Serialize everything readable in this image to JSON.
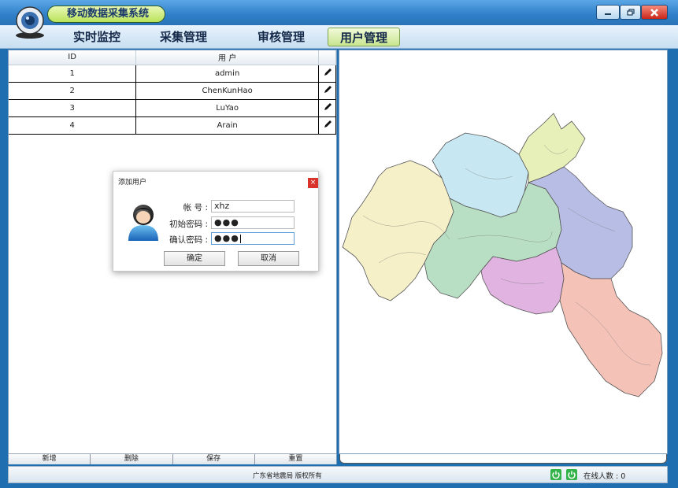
{
  "window": {
    "title": "移动数据采集系统",
    "colors": {
      "titlebar": "#2f7fc8",
      "active_tab": "#c7e48f",
      "close": "#c9261a"
    }
  },
  "menu": {
    "items": [
      {
        "label": "实时监控"
      },
      {
        "label": "采集管理"
      },
      {
        "label": "审核管理"
      },
      {
        "label": "用户管理",
        "active": true
      }
    ]
  },
  "user_table": {
    "columns": [
      "ID",
      "用 户"
    ],
    "rows": [
      {
        "id": "1",
        "user": "admin"
      },
      {
        "id": "2",
        "user": "ChenKunHao"
      },
      {
        "id": "3",
        "user": "LuYao"
      },
      {
        "id": "4",
        "user": "Arain"
      }
    ],
    "edit_icon": "pencil-icon"
  },
  "toolbar": {
    "add": "新增",
    "delete": "删除",
    "save": "保存",
    "reset": "重置"
  },
  "dialog": {
    "title": "添加用户",
    "close": "×",
    "account_label": "帐  号 :",
    "account_value": "xhz",
    "password_label": "初始密码 :",
    "password_value": "●●●",
    "confirm_label": "确认密码 :",
    "confirm_value": "●●●",
    "ok": "确定",
    "cancel": "取消"
  },
  "map": {
    "regions": [
      {
        "name": "west",
        "color": "#f5f0c8"
      },
      {
        "name": "north-west",
        "color": "#c7e8f2"
      },
      {
        "name": "north",
        "color": "#e6f0b8"
      },
      {
        "name": "central",
        "color": "#b8dfc4"
      },
      {
        "name": "east",
        "color": "#b8bde6"
      },
      {
        "name": "south-central",
        "color": "#e0b3e0"
      },
      {
        "name": "south-east",
        "color": "#f5c2b8"
      }
    ]
  },
  "status": {
    "copyright": "广东省地震局 版权所有",
    "online": "在线人数 : 0"
  }
}
